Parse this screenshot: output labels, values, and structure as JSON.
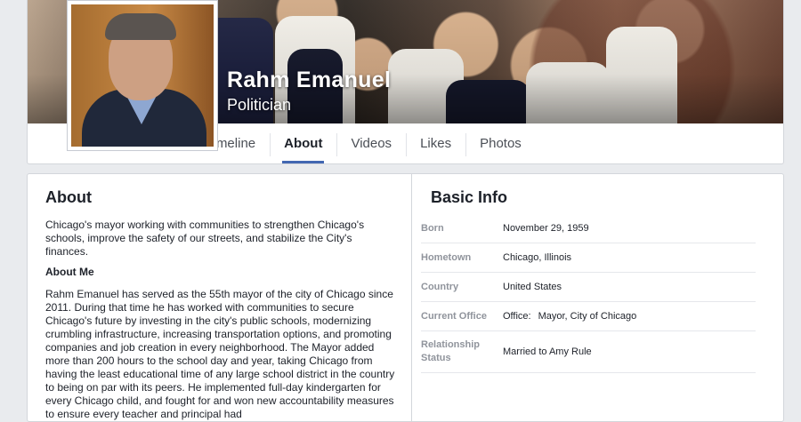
{
  "profile": {
    "name": "Rahm Emanuel",
    "category": "Politician"
  },
  "tabs": [
    {
      "label": "Timeline",
      "active": false
    },
    {
      "label": "About",
      "active": true
    },
    {
      "label": "Videos",
      "active": false
    },
    {
      "label": "Likes",
      "active": false
    },
    {
      "label": "Photos",
      "active": false
    }
  ],
  "about": {
    "title": "About",
    "intro": "Chicago's mayor working with communities to strengthen Chicago's schools, improve the safety of our streets, and stabilize the City's finances.",
    "about_me_heading": "About Me",
    "about_me_text": "Rahm Emanuel has served as the 55th mayor of the city of Chicago since 2011. During that time he has worked with communities to secure Chicago's future by investing in the city's public schools, modernizing crumbling infrastructure, increasing transportation options, and promoting companies and job creation in every neighborhood. The Mayor added more than 200 hours to the school day and year, taking Chicago from having the least educational time of any large school district in the country to being on par with its peers. He implemented full-day kindergarten for every Chicago child, and fought for and won new accountability measures to ensure every teacher and principal had"
  },
  "basic_info": {
    "title": "Basic Info",
    "born_label": "Born",
    "born_value": "November 29, 1959",
    "hometown_label": "Hometown",
    "hometown_value": "Chicago, Illinois",
    "country_label": "Country",
    "country_value": "United States",
    "office_label": "Current Office",
    "office_key": "Office:",
    "office_value": "Mayor, City of Chicago",
    "relationship_label": "Relationship Status",
    "relationship_value": "Married to Amy Rule"
  },
  "colors": {
    "accent": "#4267b2",
    "label_gray": "#90949c"
  }
}
